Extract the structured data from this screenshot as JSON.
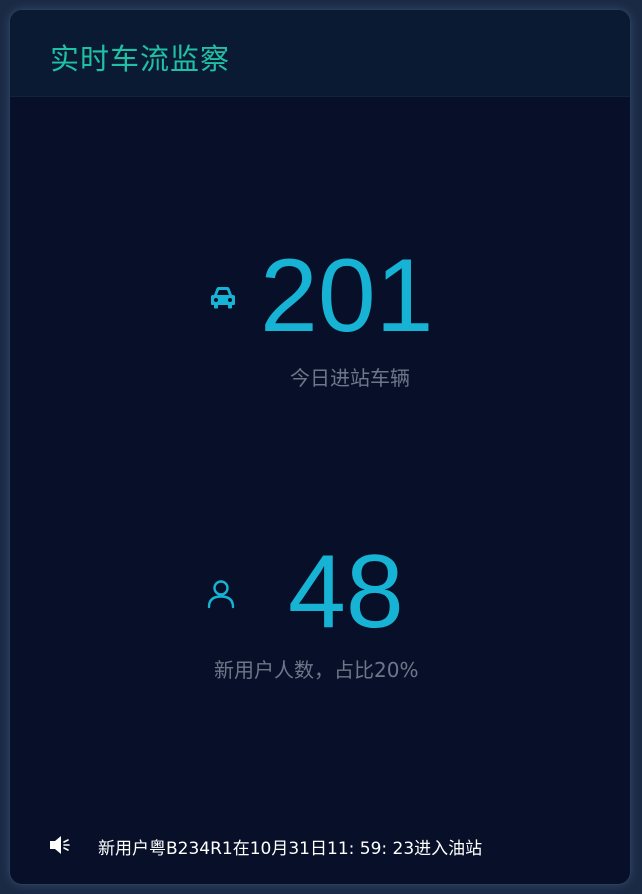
{
  "panel": {
    "title": "实时车流监察"
  },
  "stats": [
    {
      "icon": "car-icon",
      "value": "201",
      "label": "今日进站车辆"
    },
    {
      "icon": "user-icon",
      "value": "48",
      "label": "新用户人数，占比20%"
    }
  ],
  "ticker": {
    "icon": "speaker-icon",
    "text": "新用户粤B234R1在10月31日11: 59: 23进入油站"
  },
  "colors": {
    "background": "#071028",
    "header": "#0b1a33",
    "title": "#1fc0a6",
    "value": "#16b3d4",
    "label": "#6d7789"
  }
}
